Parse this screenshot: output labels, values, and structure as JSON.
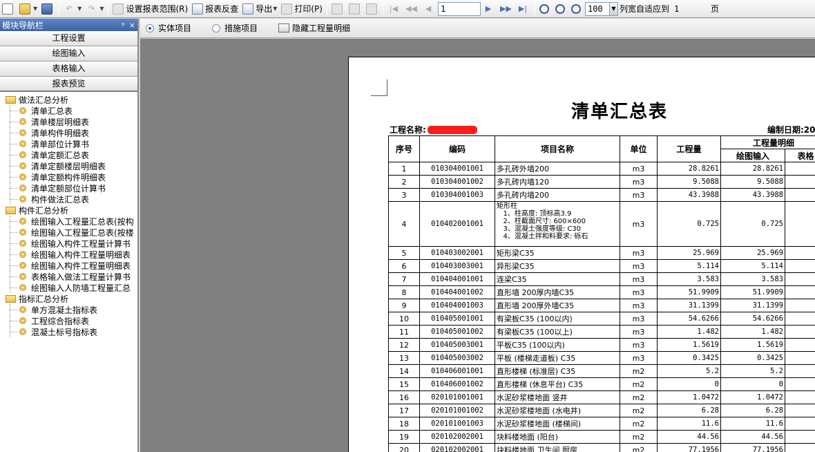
{
  "toolbar": {
    "set_range": "设置报表范围(R)",
    "reverse_check": "报表反查",
    "export": "导出",
    "print": "打印(P)",
    "page_value": "1",
    "zoom_value": "100",
    "fit_label": "列宽自适应到",
    "fit_value": "1",
    "fit_unit": "页"
  },
  "nav": {
    "title": "模块导航栏",
    "pin": "ᵖ",
    "close": "×",
    "modules": [
      "工程设置",
      "绘图输入",
      "表格输入",
      "报表预览"
    ],
    "tree": [
      {
        "type": "group",
        "label": "做法汇总分析"
      },
      {
        "type": "leaf",
        "label": "清单汇总表"
      },
      {
        "type": "leaf",
        "label": "清单楼层明细表"
      },
      {
        "type": "leaf",
        "label": "清单构件明细表"
      },
      {
        "type": "leaf",
        "label": "清单部位计算书"
      },
      {
        "type": "leaf",
        "label": "清单定额汇总表"
      },
      {
        "type": "leaf",
        "label": "清单定额楼层明细表"
      },
      {
        "type": "leaf",
        "label": "清单定额构件明细表"
      },
      {
        "type": "leaf",
        "label": "清单定额部位计算书"
      },
      {
        "type": "leaf",
        "label": "构件做法汇总表"
      },
      {
        "type": "group",
        "label": "构件汇总分析"
      },
      {
        "type": "leaf",
        "label": "绘图输入工程量汇总表(按构"
      },
      {
        "type": "leaf",
        "label": "绘图输入工程量汇总表(按楼"
      },
      {
        "type": "leaf",
        "label": "绘图输入构件工程量计算书"
      },
      {
        "type": "leaf",
        "label": "绘图输入构件工程量明细表"
      },
      {
        "type": "leaf",
        "label": "绘图输入构件工程量明细表"
      },
      {
        "type": "leaf",
        "label": "表格输入做法工程量计算书"
      },
      {
        "type": "leaf",
        "label": "绘图输入人防墙工程量汇总"
      },
      {
        "type": "group",
        "label": "指标汇总分析"
      },
      {
        "type": "leaf",
        "label": "单方混凝土指标表"
      },
      {
        "type": "leaf",
        "label": "工程综合指标表"
      },
      {
        "type": "leaf",
        "label": "混凝土标号指标表"
      }
    ]
  },
  "subbar": {
    "opt_entity": "实体项目",
    "opt_measure": "措施项目",
    "hide_detail": "隐藏工程量明细"
  },
  "report": {
    "title": "清单汇总表",
    "project_label": "工程名称:",
    "date_label": "编制日期:20",
    "headers": {
      "no": "序号",
      "code": "编码",
      "name": "项目名称",
      "unit": "单位",
      "qty": "工程量",
      "detail": "工程量明细",
      "drawing": "绘图输入",
      "table": "表格"
    },
    "rows": [
      {
        "no": "1",
        "code": "010304001001",
        "name": "多孔砖外墙200",
        "unit": "m3",
        "qty": "28.8261",
        "drawing": "28.8261"
      },
      {
        "no": "2",
        "code": "010304001002",
        "name": "多孔砖内墙120",
        "unit": "m3",
        "qty": "9.5088",
        "drawing": "9.5088"
      },
      {
        "no": "3",
        "code": "010304001003",
        "name": "多孔砖内墙200",
        "unit": "m3",
        "qty": "43.3988",
        "drawing": "43.3988"
      },
      {
        "no": "4",
        "code": "010402001001",
        "name": "矩形柱\n   1、柱高度: 顶标高3.9\n   2、柱截面尺寸: 600×600\n   3、混凝土强度等级: C30\n   4、混凝土拌和料要求: 砾石",
        "unit": "m3",
        "qty": "0.725",
        "drawing": "0.725",
        "multi": true
      },
      {
        "no": "5",
        "code": "010403002001",
        "name": "矩形梁C35",
        "unit": "m3",
        "qty": "25.969",
        "drawing": "25.969"
      },
      {
        "no": "6",
        "code": "010403003001",
        "name": "异形梁C35",
        "unit": "m3",
        "qty": "5.114",
        "drawing": "5.114"
      },
      {
        "no": "7",
        "code": "010404001001",
        "name": "连梁C35",
        "unit": "m3",
        "qty": "3.583",
        "drawing": "3.583"
      },
      {
        "no": "8",
        "code": "010404001002",
        "name": "直形墙 200厚内墙C35",
        "unit": "m3",
        "qty": "51.9909",
        "drawing": "51.9909"
      },
      {
        "no": "9",
        "code": "010404001003",
        "name": "直形墙 200厚外墙C35",
        "unit": "m3",
        "qty": "31.1399",
        "drawing": "31.1399"
      },
      {
        "no": "10",
        "code": "010405001001",
        "name": "有梁板C35 (100以内)",
        "unit": "m3",
        "qty": "54.6266",
        "drawing": "54.6266"
      },
      {
        "no": "11",
        "code": "010405001002",
        "name": "有梁板C35 (100以上)",
        "unit": "m3",
        "qty": "1.482",
        "drawing": "1.482"
      },
      {
        "no": "12",
        "code": "010405003001",
        "name": "平板C35 (100以内)",
        "unit": "m3",
        "qty": "1.5619",
        "drawing": "1.5619"
      },
      {
        "no": "13",
        "code": "010405003002",
        "name": "平板 (楼梯走道板) C35",
        "unit": "m3",
        "qty": "0.3425",
        "drawing": "0.3425"
      },
      {
        "no": "14",
        "code": "010406001001",
        "name": "直形楼梯 (标准层) C35",
        "unit": "m2",
        "qty": "5.2",
        "drawing": "5.2"
      },
      {
        "no": "15",
        "code": "010406001002",
        "name": "直形楼梯 (休息平台) C35",
        "unit": "m2",
        "qty": "0",
        "drawing": "0"
      },
      {
        "no": "16",
        "code": "020101001001",
        "name": "水泥砂浆楼地面 竖井",
        "unit": "m2",
        "qty": "1.0472",
        "drawing": "1.0472"
      },
      {
        "no": "17",
        "code": "020101001002",
        "name": "水泥砂浆楼地面 (水电井)",
        "unit": "m2",
        "qty": "6.28",
        "drawing": "6.28"
      },
      {
        "no": "18",
        "code": "020101001003",
        "name": "水泥砂浆楼地面 (楼梯间)",
        "unit": "m2",
        "qty": "11.6",
        "drawing": "11.6"
      },
      {
        "no": "19",
        "code": "020102002001",
        "name": "块料楼地面 (阳台)",
        "unit": "m2",
        "qty": "44.56",
        "drawing": "44.56"
      },
      {
        "no": "20",
        "code": "020102002001",
        "name": "块料楼地面 卫生间 厨房",
        "unit": "m2",
        "qty": "77.1956",
        "drawing": "77.1956"
      }
    ]
  }
}
